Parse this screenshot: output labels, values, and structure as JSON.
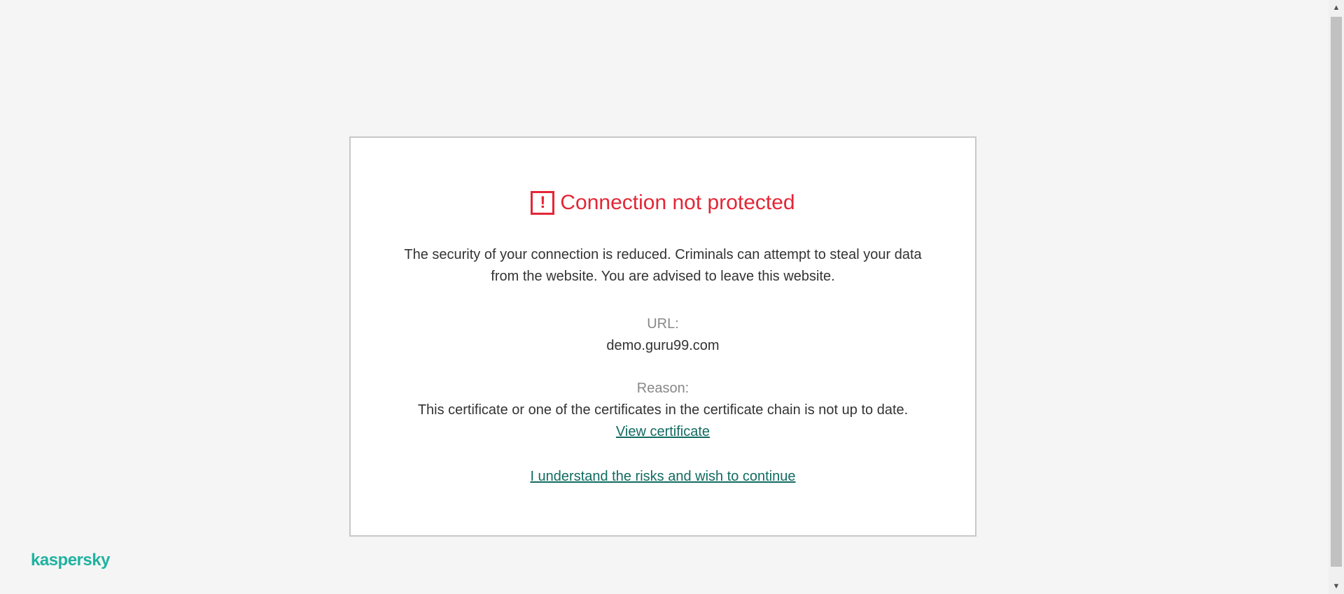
{
  "warning": {
    "icon": "alert-square-icon",
    "title": "Connection not protected",
    "description": "The security of your connection is reduced. Criminals can attempt to steal your data from the website. You are advised to leave this website.",
    "url_label": "URL:",
    "url_value": "demo.guru99.com",
    "reason_label": "Reason:",
    "reason_value": "This certificate or one of the certificates in the certificate chain is not up to date.",
    "view_certificate_link": "View certificate",
    "continue_link": "I understand the risks and wish to continue"
  },
  "brand": {
    "logo_text": "kaspersky"
  },
  "colors": {
    "alert": "#e32636",
    "link": "#116b61",
    "brand": "#20b2a0",
    "background": "#f5f5f5"
  },
  "scrollbar": {
    "up_icon": "scroll-up-arrow-icon",
    "down_icon": "scroll-down-arrow-icon"
  }
}
